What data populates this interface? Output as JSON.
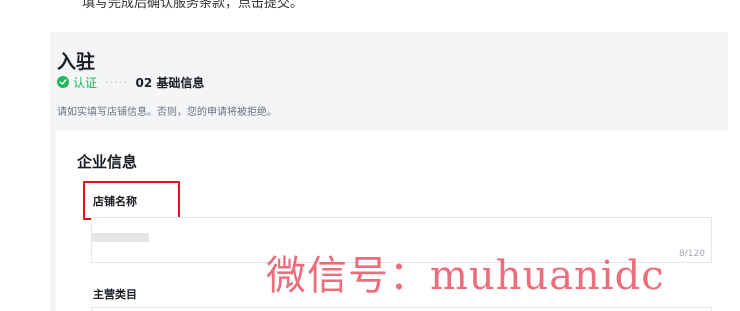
{
  "instruction": "填写完成后确认服务条款，点击提交。",
  "page": {
    "title": "入驻",
    "notice": "请如实填写店铺信息。否则，您的申请将被拒绝。"
  },
  "steps": [
    {
      "label": "认证",
      "status": "done",
      "color": "#1fb85b"
    },
    {
      "label": "02 基础信息",
      "status": "current"
    }
  ],
  "steps_separator": "·····",
  "form": {
    "section_title": "企业信息",
    "fields": [
      {
        "label": "店铺名称",
        "counter": "8/120"
      },
      {
        "label": "主营类目"
      }
    ]
  },
  "highlight_color": "#e0141e",
  "watermark": "微信号：muhuanidc"
}
